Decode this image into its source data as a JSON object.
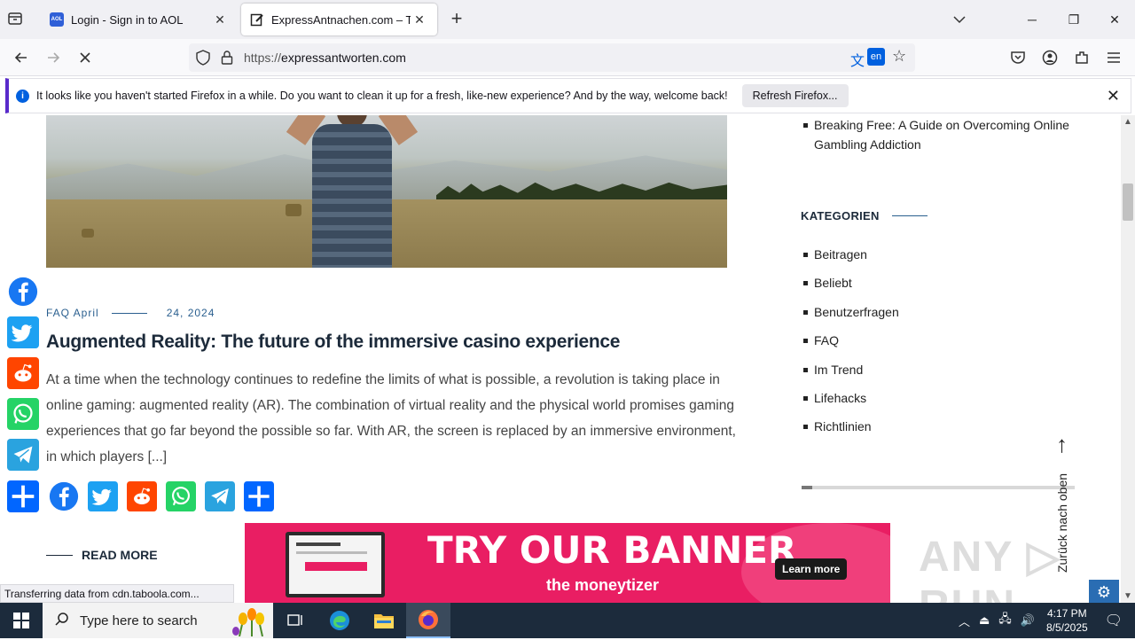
{
  "browser": {
    "tabs": [
      {
        "title": "Login - Sign in to AOL",
        "favicon": "aol-icon",
        "favicon_text": "AOL"
      },
      {
        "title": "ExpressAntnachen.com – The m",
        "favicon": "edit-icon",
        "active": true
      }
    ],
    "url_host": "expressantworten.com",
    "url_prefix": "https://",
    "translate_lang": "en",
    "notification": {
      "text": "It looks like you haven't started Firefox in a while. Do you want to clean it up for a fresh, like-new experience? And by the way, welcome back!",
      "button": "Refresh Firefox..."
    },
    "status_text": "Transferring data from cdn.taboola.com..."
  },
  "article": {
    "meta_category": "FAQ April",
    "meta_date": "24, 2024",
    "title": "Augmented Reality: The future of the immersive casino experience",
    "excerpt": "At a time when the technology continues to redefine the limits of what is possible, a revolution is taking place in online gaming: augmented reality (AR). The combination of virtual reality and the physical world promises gaming experiences that go far beyond the possible so far. With AR, the screen is replaced by an immersive environment, in which players [...]",
    "read_more": "READ MORE"
  },
  "share_icons": [
    "facebook-icon",
    "twitter-icon",
    "reddit-icon",
    "whatsapp-icon",
    "telegram-icon",
    "share-icon"
  ],
  "banner": {
    "headline": "TRY OUR BANNER",
    "cta": "Learn more",
    "brand": "the moneytizer"
  },
  "sidebar": {
    "recent_post": "Breaking Free: A Guide on Overcoming Online Gambling Addiction",
    "categories_heading": "KATEGORIEN",
    "categories": [
      "Beitragen",
      "Beliebt",
      "Benutzerfragen",
      "FAQ",
      "Im Trend",
      "Lifehacks",
      "Richtlinien"
    ],
    "progress_fraction": 0.04,
    "back_to_top": "Zurück nach oben"
  },
  "watermark": "ANY RUN",
  "taskbar": {
    "search_placeholder": "Type here to search",
    "time": "4:17 PM",
    "date": "8/5/2025"
  },
  "colors": {
    "accent": "#2a5f8f",
    "banner_bg": "#e91e63",
    "facebook": "#1877f2",
    "twitter": "#1da1f2",
    "reddit": "#ff4500",
    "whatsapp": "#25d366",
    "telegram": "#2aa3df",
    "share": "#0166ff"
  }
}
